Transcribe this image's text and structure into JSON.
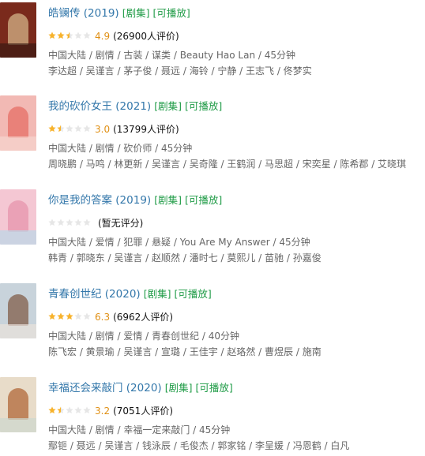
{
  "colors": {
    "link": "#3377aa",
    "tag": "#1f9b46",
    "score": "#e09015",
    "meta": "#666666"
  },
  "items": [
    {
      "title": "皓镧传 (2019)",
      "tag1": "[剧集]",
      "tag2": "[可播放]",
      "stars_filled": 2.5,
      "score": "4.9",
      "votes": "(26900人评价)",
      "meta": "中国大陆 / 剧情 / 古装 / 谋类 / Beauty Hao Lan / 45分钟",
      "cast": "李达超 / 吴谨言 / 茅子俊 / 聂远 / 海铃 / 宁静 / 王志飞 / 佟梦实",
      "poster_colors": [
        "#7a2a1c",
        "#c9a27a",
        "#3b1a12"
      ]
    },
    {
      "title": "我的砍价女王 (2021)",
      "tag1": "[剧集]",
      "tag2": "[可播放]",
      "stars_filled": 1.5,
      "score": "3.0",
      "votes": "(13799人评价)",
      "meta": "中国大陆 / 剧情 / 砍价师 / 45分钟",
      "cast": "周晓鹏 / 马鸣 / 林更新 / 吴谨言 / 吴奇隆 / 王鹤润 / 马思超 / 宋奕星 / 陈希郡 / 艾晓琪",
      "poster_colors": [
        "#f2b9b4",
        "#e8776f",
        "#f7d6cf"
      ]
    },
    {
      "title": "你是我的答案 (2019)",
      "tag1": "[剧集]",
      "tag2": "[可播放]",
      "stars_filled": 0,
      "score": "",
      "votes": "(暂无评分)",
      "meta": "中国大陆 / 爱情 / 犯罪 / 悬疑 / You Are My Answer / 45分钟",
      "cast": "韩青 / 郭晓东 / 吴谨言 / 赵顺然 / 潘时七 / 莫熙儿 / 苗驰 / 孙嘉俊",
      "poster_colors": [
        "#f4c7d3",
        "#e79ab0",
        "#b9d8e8"
      ]
    },
    {
      "title": "青春创世纪 (2020)",
      "tag1": "[剧集]",
      "tag2": "[可播放]",
      "stars_filled": 3,
      "score": "6.3",
      "votes": "(6962人评价)",
      "meta": "中国大陆 / 剧情 / 爱情 / 青春创世纪 / 40分钟",
      "cast": "陈飞宏 / 黄景瑜 / 吴谨言 / 宣璐 / 王佳宇 / 赵珞然 / 曹煜辰 / 施南",
      "poster_colors": [
        "#c8d3db",
        "#8a6b5a",
        "#e9e3dc"
      ]
    },
    {
      "title": "幸福还会来敲门 (2020)",
      "tag1": "[剧集]",
      "tag2": "[可播放]",
      "stars_filled": 1.5,
      "score": "3.2",
      "votes": "(7051人评价)",
      "meta": "中国大陆 / 剧情 / 幸福一定来敲门 / 45分钟",
      "cast": "鄢钷 / 聂远 / 吴谨言 / 钱泳辰 / 毛俊杰 / 郭家铭 / 李呈媛 / 冯恩鹤 / 白凡",
      "poster_colors": [
        "#e8dcc9",
        "#b7764a",
        "#cdd7cf"
      ]
    }
  ]
}
